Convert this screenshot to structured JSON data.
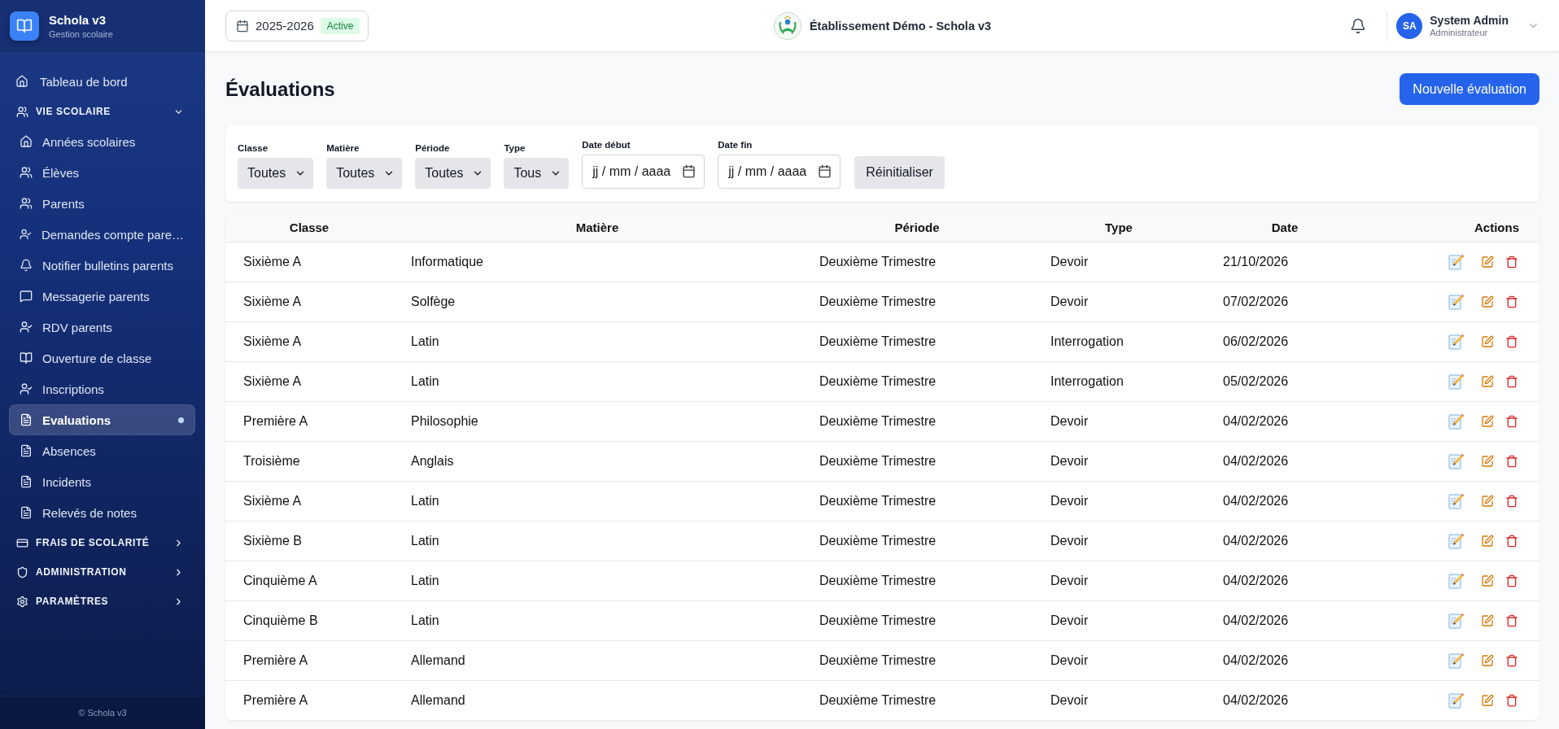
{
  "sidebar": {
    "brand": {
      "title": "Schola v3",
      "subtitle": "Gestion scolaire"
    },
    "items": [
      {
        "kind": "link",
        "label": "Tableau de bord",
        "selected": false
      },
      {
        "kind": "section",
        "label": "VIE SCOLAIRE",
        "expanded": true,
        "children": [
          {
            "label": "Années scolaires",
            "selected": false
          },
          {
            "label": "Élèves",
            "selected": false
          },
          {
            "label": "Parents",
            "selected": false
          },
          {
            "label": "Demandes compte pare…",
            "selected": false
          },
          {
            "label": "Notifier bulletins parents",
            "selected": false
          },
          {
            "label": "Messagerie parents",
            "selected": false
          },
          {
            "label": "RDV parents",
            "selected": false
          },
          {
            "label": "Ouverture de classe",
            "selected": false
          },
          {
            "label": "Inscriptions",
            "selected": false
          },
          {
            "label": "Evaluations",
            "selected": true
          },
          {
            "label": "Absences",
            "selected": false
          },
          {
            "label": "Incidents",
            "selected": false
          },
          {
            "label": "Relevés de notes",
            "selected": false
          }
        ]
      },
      {
        "kind": "section",
        "label": "FRAIS DE SCOLARITÉ",
        "expanded": false
      },
      {
        "kind": "section",
        "label": "ADMINISTRATION",
        "expanded": false
      },
      {
        "kind": "section",
        "label": "PARAMÈTRES",
        "expanded": false
      }
    ],
    "footer": "© Schola v3"
  },
  "header": {
    "school_year": {
      "label": "2025-2026",
      "badge": "Active"
    },
    "school_name": "Établissement Démo - Schola v3",
    "user": {
      "initials": "SA",
      "name": "System Admin",
      "role": "Administrateur"
    }
  },
  "page": {
    "title": "Évaluations",
    "new_button": "Nouvelle évaluation"
  },
  "filters": {
    "fields": [
      {
        "kind": "select",
        "label": "Classe",
        "value": "Toutes"
      },
      {
        "kind": "select",
        "label": "Matière",
        "value": "Toutes"
      },
      {
        "kind": "select",
        "label": "Période",
        "value": "Toutes"
      },
      {
        "kind": "select",
        "label": "Type",
        "value": "Tous"
      },
      {
        "kind": "date",
        "label": "Date début",
        "placeholder": "jj / mm / aaaa"
      },
      {
        "kind": "date",
        "label": "Date fin",
        "placeholder": "jj / mm / aaaa"
      }
    ],
    "reset_button": "Réinitialiser"
  },
  "table": {
    "columns": [
      "Classe",
      "Matière",
      "Période",
      "Type",
      "Date",
      "Actions"
    ],
    "rows": [
      {
        "class": "Sixième A",
        "subject": "Informatique",
        "period": "Deuxième Trimestre",
        "type": "Devoir",
        "date": "21/10/2026"
      },
      {
        "class": "Sixième A",
        "subject": "Solfège",
        "period": "Deuxième Trimestre",
        "type": "Devoir",
        "date": "07/02/2026"
      },
      {
        "class": "Sixième A",
        "subject": "Latin",
        "period": "Deuxième Trimestre",
        "type": "Interrogation",
        "date": "06/02/2026"
      },
      {
        "class": "Sixième A",
        "subject": "Latin",
        "period": "Deuxième Trimestre",
        "type": "Interrogation",
        "date": "05/02/2026"
      },
      {
        "class": "Première A",
        "subject": "Philosophie",
        "period": "Deuxième Trimestre",
        "type": "Devoir",
        "date": "04/02/2026"
      },
      {
        "class": "Troisième",
        "subject": "Anglais",
        "period": "Deuxième Trimestre",
        "type": "Devoir",
        "date": "04/02/2026"
      },
      {
        "class": "Sixième A",
        "subject": "Latin",
        "period": "Deuxième Trimestre",
        "type": "Devoir",
        "date": "04/02/2026"
      },
      {
        "class": "Sixième B",
        "subject": "Latin",
        "period": "Deuxième Trimestre",
        "type": "Devoir",
        "date": "04/02/2026"
      },
      {
        "class": "Cinquième A",
        "subject": "Latin",
        "period": "Deuxième Trimestre",
        "type": "Devoir",
        "date": "04/02/2026"
      },
      {
        "class": "Cinquième B",
        "subject": "Latin",
        "period": "Deuxième Trimestre",
        "type": "Devoir",
        "date": "04/02/2026"
      },
      {
        "class": "Première A",
        "subject": "Allemand",
        "period": "Deuxième Trimestre",
        "type": "Devoir",
        "date": "04/02/2026"
      },
      {
        "class": "Première A",
        "subject": "Allemand",
        "period": "Deuxième Trimestre",
        "type": "Devoir",
        "date": "04/02/2026"
      }
    ]
  }
}
